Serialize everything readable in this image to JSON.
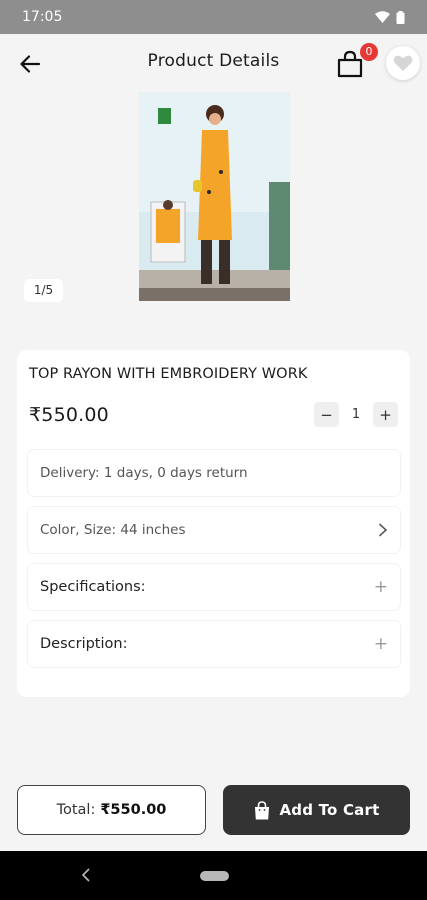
{
  "status_bar": {
    "time": "17:05"
  },
  "header": {
    "title": "Product Details",
    "cart_count": "0"
  },
  "gallery": {
    "counter": "1/5"
  },
  "product": {
    "name": "TOP RAYON WITH EMBROIDERY WORK",
    "price": "₹550.00",
    "quantity": "1",
    "qty_minus": "−",
    "qty_plus": "+"
  },
  "details": {
    "delivery": "Delivery: 1 days, 0 days return",
    "variant_label": "Color, Size:",
    "variant_value": "44 inches",
    "specifications": "Specifications:",
    "description": "Description:",
    "expand_icon": "+"
  },
  "footer": {
    "total_label": "Total:",
    "total_amount": "₹550.00",
    "add_to_cart": "Add To Cart"
  },
  "colors": {
    "accent": "#333333",
    "badge": "#e53935",
    "garment": "#f5a42a"
  }
}
